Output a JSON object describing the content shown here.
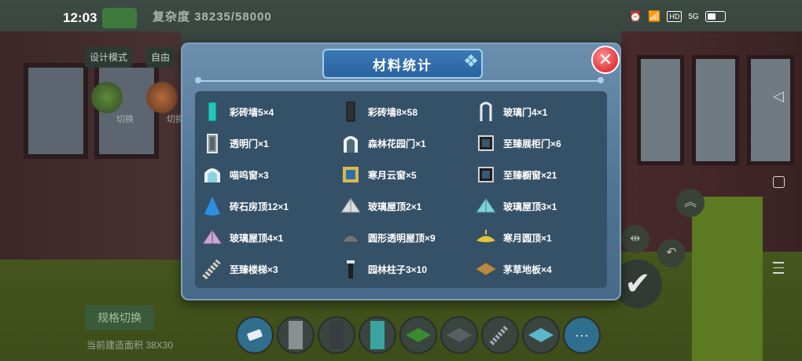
{
  "status_bar": {
    "time": "12:03",
    "network_badge": "HD",
    "signal": "5G"
  },
  "background": {
    "space_label": "复杂度 38235/58000",
    "mode_button": "设计模式",
    "mode_button_2": "自由",
    "round_labels": [
      "切换",
      "切换"
    ],
    "spec_button": "规格切换",
    "area_text": "当前建造面积 38X30"
  },
  "dialog": {
    "title": "材料统计",
    "close_symbol": "✕",
    "items": [
      {
        "label": "彩砖墙5×4",
        "icon": "cyan-wall-panel-icon"
      },
      {
        "label": "彩砖墙8×58",
        "icon": "dark-wall-panel-icon"
      },
      {
        "label": "玻璃门4×1",
        "icon": "glass-door-icon"
      },
      {
        "label": "透明门×1",
        "icon": "transparent-door-icon"
      },
      {
        "label": "森林花园门×1",
        "icon": "forest-garden-gate-icon"
      },
      {
        "label": "至臻展柜门×6",
        "icon": "display-cabinet-door-icon"
      },
      {
        "label": "喵呜窗×3",
        "icon": "cat-window-icon"
      },
      {
        "label": "寒月云窗×5",
        "icon": "moon-cloud-window-icon"
      },
      {
        "label": "至臻橱窗×21",
        "icon": "showcase-window-icon"
      },
      {
        "label": "砖石房顶12×1",
        "icon": "cone-roof-icon"
      },
      {
        "label": "玻璃屋顶2×1",
        "icon": "glass-pyramid-roof-icon"
      },
      {
        "label": "玻璃屋顶3×1",
        "icon": "glass-pyramid-roof-teal-icon"
      },
      {
        "label": "玻璃屋顶4×1",
        "icon": "glass-pyramid-roof-purple-icon"
      },
      {
        "label": "圆形透明屋顶×9",
        "icon": "dome-roof-icon"
      },
      {
        "label": "寒月圆顶×1",
        "icon": "golden-dome-icon"
      },
      {
        "label": "至臻楼梯×3",
        "icon": "staircase-icon"
      },
      {
        "label": "园林柱子3×10",
        "icon": "garden-pillar-icon"
      },
      {
        "label": "茅草地板×4",
        "icon": "thatch-floor-icon"
      }
    ]
  },
  "toolbar": {
    "more_label": "···"
  },
  "colors": {
    "dialog_bg": "#5b7ea0",
    "panel_bg": "#355168",
    "title_plate": "#2f69a6",
    "close": "#e0383f"
  }
}
